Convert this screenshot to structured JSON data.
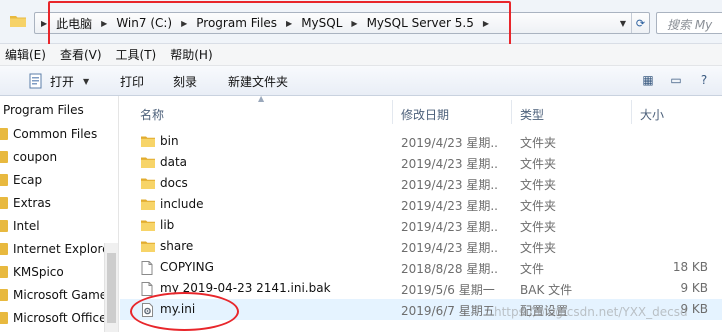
{
  "address": {
    "crumbs": [
      "此电脑",
      "Win7 (C:)",
      "Program Files",
      "MySQL",
      "MySQL Server 5.5"
    ],
    "search_placeholder": "搜索 My"
  },
  "menu": [
    "编辑(E)",
    "查看(V)",
    "工具(T)",
    "帮助(H)"
  ],
  "toolbar": {
    "open_label": "打开",
    "print_label": "打印",
    "burn_label": "刻录",
    "new_folder_label": "新建文件夹"
  },
  "nav": {
    "heading": "Program Files",
    "items": [
      "Common Files",
      "coupon",
      "Ecap",
      "Extras",
      "Intel",
      "Internet Explore",
      "KMSpico",
      "Microsoft Game",
      "Microsoft Office"
    ]
  },
  "columns": {
    "name": "名称",
    "date": "修改日期",
    "type": "类型",
    "size": "大小"
  },
  "files": [
    {
      "name": "bin",
      "date": "2019/4/23 星期...",
      "type": "文件夹",
      "size": "",
      "icon": "folder-icon"
    },
    {
      "name": "data",
      "date": "2019/4/23 星期...",
      "type": "文件夹",
      "size": "",
      "icon": "folder-icon"
    },
    {
      "name": "docs",
      "date": "2019/4/23 星期...",
      "type": "文件夹",
      "size": "",
      "icon": "folder-icon"
    },
    {
      "name": "include",
      "date": "2019/4/23 星期...",
      "type": "文件夹",
      "size": "",
      "icon": "folder-icon"
    },
    {
      "name": "lib",
      "date": "2019/4/23 星期...",
      "type": "文件夹",
      "size": "",
      "icon": "folder-icon"
    },
    {
      "name": "share",
      "date": "2019/4/23 星期...",
      "type": "文件夹",
      "size": "",
      "icon": "folder-icon"
    },
    {
      "name": "COPYING",
      "date": "2018/8/28 星期...",
      "type": "文件",
      "size": "18 KB",
      "icon": "file-icon"
    },
    {
      "name": "my 2019-04-23 2141.ini.bak",
      "date": "2019/5/6 星期一 ...",
      "type": "BAK 文件",
      "size": "9 KB",
      "icon": "file-icon"
    },
    {
      "name": "my.ini",
      "date": "2019/6/7 星期五 ...",
      "type": "配置设置",
      "size": "9 KB",
      "icon": "config-file-icon"
    }
  ],
  "watermark": "https://blog.csdn.net/YXX_decsd",
  "colors": {
    "annotation_red": "#e8262b",
    "folder_yellow": "#e8b93f",
    "selection": "#e5f3ff"
  }
}
